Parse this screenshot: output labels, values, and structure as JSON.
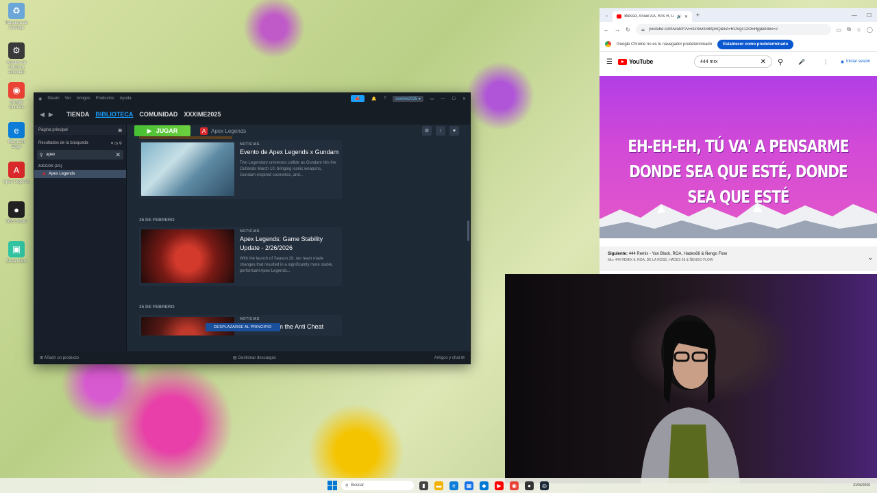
{
  "desktop": {
    "icons": [
      {
        "label": "Papelera de reciclaje",
        "icon": "recycle-bin-icon",
        "color": "#6aa6d8",
        "glyph": "♻"
      },
      {
        "label": "Ajustes de cuenta y actividad",
        "icon": "settings-app-icon",
        "color": "#3a3a3a",
        "glyph": "⚙"
      },
      {
        "label": "Google Chrome",
        "icon": "chrome-icon",
        "color": "#ea4335",
        "glyph": "◉"
      },
      {
        "label": "Microsoft Edge",
        "icon": "edge-icon",
        "color": "#0c7dd9",
        "glyph": "e"
      },
      {
        "label": "Apex Legends",
        "icon": "apex-icon",
        "color": "#da292a",
        "glyph": "A"
      },
      {
        "label": "OBS Studio",
        "icon": "obs-icon",
        "color": "#222",
        "glyph": "●"
      },
      {
        "label": "Streamlabs",
        "icon": "streamlabs-icon",
        "color": "#31c3a2",
        "glyph": "▣"
      }
    ]
  },
  "steam": {
    "menu": [
      "Steam",
      "Ver",
      "Amigos",
      "Productos",
      "Ayuda"
    ],
    "account": "xxxime2025 ▾",
    "nav": {
      "store": "TIENDA",
      "library": "BIBLIOTECA",
      "community": "COMUNIDAD",
      "profile": "XXXIME2025"
    },
    "sidebar": {
      "home": "Página principal",
      "results": "Resultados de la búsqueda",
      "search_value": "apex",
      "category": "JUEGOS (1/1)",
      "game": "Apex Legends"
    },
    "game_bar": {
      "play": "JUGAR",
      "title": "Apex Legends"
    },
    "feed": {
      "card1": {
        "tag": "NOTICIAS",
        "title": "Evento de Apex Legends x Gundam",
        "desc": "Two Legendary universes collide as Gundam hits the Outlands March 10, bringing iconic weapons, Gundam-inspired cosmetics, and..."
      },
      "date2": "26 DE FEBRERO",
      "card2": {
        "tag": "NOTICIAS",
        "title": "Apex Legends: Game Stability Update - 2/26/2026",
        "desc": "With the launch of Season 28, our team made changes that resulted in a significantly more stable, performant Apex Legends..."
      },
      "date3": "25 DE FEBRERO",
      "card3": {
        "tag": "NOTICIAS",
        "title": "An Update from the Anti Cheat"
      },
      "scroll_top": "DESPLAZARSE AL PRINCIPIO"
    },
    "footer": {
      "add": "Añadir un producto",
      "downloads": "Gestionar descargas",
      "friends": "Amigos y chat"
    }
  },
  "chrome": {
    "tab_title": "Blessd, Anuel AA, Kris R, Lu...",
    "url": "youtube.com/watch?v=cGSwcGBhpSQ&list=RDVgc12OEHjg&index=2",
    "info_text": "Google Chrome no es tu navegador predeterminado",
    "info_button": "Establecer como predeterminado",
    "youtube": {
      "logo": "YouTube",
      "search_value": "444 mrx",
      "signin": "Iniciar sesión",
      "lyrics_line1": "EH-EH-EH, TÚ VA' A PENSARME",
      "lyrics_line2": "DONDE SEA QUE ESTÉ, DONDE SEA QUE ESTÉ",
      "next_label": "Siguiente:",
      "next_title": "444 Remix - Yan Block, ROA, Hades66 & Ñengo Flow",
      "next_sub": "Mix: 444 REMIX ft. ROA, DE LA ROSE, HADES 66 & ÑENGO FLOW"
    }
  },
  "taskbar": {
    "search_placeholder": "Buscar",
    "clock_date": "31/03/2026"
  }
}
